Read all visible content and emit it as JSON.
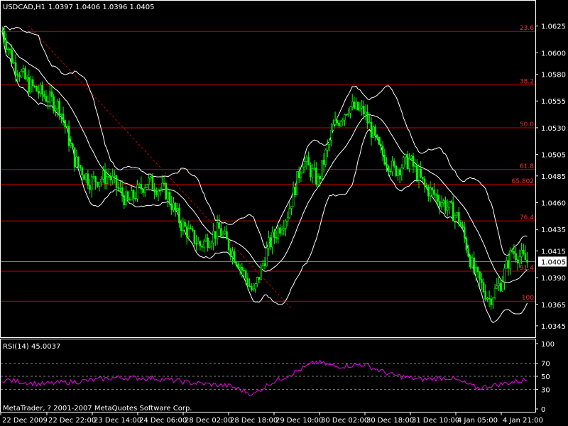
{
  "header": {
    "symbol_text": "USDCAD,H1",
    "quote_text": "1.0397 1.0406 1.0396 1.0405"
  },
  "rsi_panel": {
    "label": "RSI(14) 45.0037",
    "copyright": "MetaTrader, ? 2001-2007 MetaQuotes Software Corp."
  },
  "colors": {
    "background": "#000000",
    "candle": "#00ff00",
    "fib_line": "#ff0000",
    "bands": "#ffffff",
    "rsi": "#ee00ee",
    "axis": "#ffffff",
    "grid": "#808080",
    "trendline": "#ff0000",
    "current_price_line": "#808080"
  },
  "chart_data": [
    {
      "type": "candlestick",
      "title": "USDCAD,H1",
      "ohlc_last": {
        "open": 1.0397,
        "high": 1.0406,
        "low": 1.0396,
        "close": 1.0405
      },
      "price_axis_ticks": [
        "1.0625",
        "1.0600",
        "1.0580",
        "1.0555",
        "1.0530",
        "1.0505",
        "1.0485",
        "1.0460",
        "1.0435",
        "1.0415",
        "1.0390",
        "1.0365",
        "1.0345"
      ],
      "price_axis_values": [
        1.0625,
        1.06,
        1.058,
        1.0555,
        1.053,
        1.0505,
        1.0485,
        1.046,
        1.0435,
        1.0415,
        1.039,
        1.0365,
        1.0345
      ],
      "current_price": 1.0405,
      "current_price_label": "1.0405",
      "ylim": [
        1.0335,
        1.0648
      ],
      "time_axis_ticks": [
        "22 Dec 2009",
        "22 Dec 22:00",
        "23 Dec 14:00",
        "24 Dec 06:00",
        "28 Dec 02:00",
        "28 Dec 18:00",
        "29 Dec 10:00",
        "30 Dec 02:00",
        "30 Dec 18:00",
        "31 Dec 10:00",
        "4 Jan 05:00",
        "4 Jan 21:00"
      ],
      "fibonacci_levels": [
        {
          "label": "23.6",
          "price": 1.062
        },
        {
          "label": "38.2",
          "price": 1.057
        },
        {
          "label": "50.0",
          "price": 1.053
        },
        {
          "label": "61.8",
          "price": 1.0491
        },
        {
          "label": "65.802",
          "price": 1.0477
        },
        {
          "label": "76.4",
          "price": 1.0443
        },
        {
          "label": "91.4",
          "price": 1.0396
        },
        {
          "label": "100",
          "price": 1.0368
        }
      ],
      "candle_anchors": [
        {
          "i": 0,
          "p": 1.062
        },
        {
          "i": 6,
          "p": 1.059
        },
        {
          "i": 14,
          "p": 1.057
        },
        {
          "i": 22,
          "p": 1.056
        },
        {
          "i": 30,
          "p": 1.055
        },
        {
          "i": 38,
          "p": 1.05
        },
        {
          "i": 46,
          "p": 1.048
        },
        {
          "i": 56,
          "p": 1.0485
        },
        {
          "i": 66,
          "p": 1.046
        },
        {
          "i": 76,
          "p": 1.048
        },
        {
          "i": 86,
          "p": 1.047
        },
        {
          "i": 94,
          "p": 1.044
        },
        {
          "i": 104,
          "p": 1.042
        },
        {
          "i": 114,
          "p": 1.0435
        },
        {
          "i": 124,
          "p": 1.0405
        },
        {
          "i": 132,
          "p": 1.0375
        },
        {
          "i": 140,
          "p": 1.042
        },
        {
          "i": 150,
          "p": 1.045
        },
        {
          "i": 158,
          "p": 1.05
        },
        {
          "i": 166,
          "p": 1.048
        },
        {
          "i": 174,
          "p": 1.053
        },
        {
          "i": 182,
          "p": 1.055
        },
        {
          "i": 190,
          "p": 1.0545
        },
        {
          "i": 198,
          "p": 1.051
        },
        {
          "i": 206,
          "p": 1.049
        },
        {
          "i": 214,
          "p": 1.05
        },
        {
          "i": 222,
          "p": 1.0475
        },
        {
          "i": 232,
          "p": 1.046
        },
        {
          "i": 240,
          "p": 1.0445
        },
        {
          "i": 248,
          "p": 1.0395
        },
        {
          "i": 256,
          "p": 1.037
        },
        {
          "i": 262,
          "p": 1.0385
        },
        {
          "i": 268,
          "p": 1.0415
        },
        {
          "i": 276,
          "p": 1.0405
        }
      ]
    },
    {
      "type": "line",
      "title": "RSI(14) 45.0037",
      "ylim": [
        0,
        100
      ],
      "y_ticks": [
        "100",
        "70",
        "50",
        "30",
        "0"
      ],
      "y_tick_values": [
        100,
        70,
        50,
        30,
        0
      ],
      "levels": [
        70,
        50,
        30
      ],
      "last_value": 45.0037,
      "anchors": [
        {
          "i": 0,
          "v": 45
        },
        {
          "i": 20,
          "v": 38
        },
        {
          "i": 40,
          "v": 42
        },
        {
          "i": 60,
          "v": 48
        },
        {
          "i": 80,
          "v": 47
        },
        {
          "i": 100,
          "v": 40
        },
        {
          "i": 120,
          "v": 35
        },
        {
          "i": 132,
          "v": 22
        },
        {
          "i": 140,
          "v": 38
        },
        {
          "i": 155,
          "v": 58
        },
        {
          "i": 165,
          "v": 72
        },
        {
          "i": 175,
          "v": 65
        },
        {
          "i": 190,
          "v": 68
        },
        {
          "i": 205,
          "v": 52
        },
        {
          "i": 220,
          "v": 45
        },
        {
          "i": 235,
          "v": 48
        },
        {
          "i": 250,
          "v": 32
        },
        {
          "i": 262,
          "v": 38
        },
        {
          "i": 276,
          "v": 45
        }
      ]
    }
  ]
}
